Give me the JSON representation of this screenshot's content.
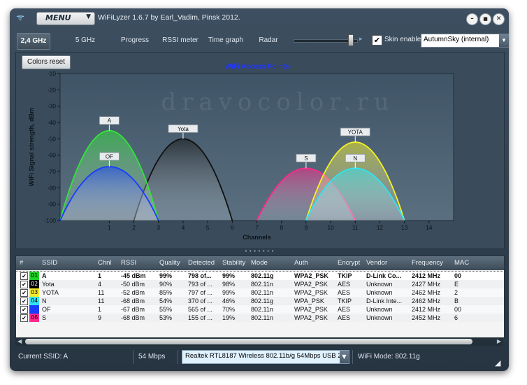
{
  "window": {
    "title": "WiFiLyzer 1.6.7 by Earl_Vadim,  Pinsk 2012.",
    "menu_label": "MENU",
    "controls": {
      "minimize": "–",
      "maximize": "■",
      "close": "✕"
    }
  },
  "toolbar": {
    "tabs": [
      "2,4 GHz",
      "5 GHz",
      "Progress",
      "RSSI meter",
      "Time graph",
      "Radar"
    ],
    "active_tab": "2,4 GHz",
    "slider_level": 0.88,
    "skin_enable_label": "Skin enable",
    "skin_enable_checked": true,
    "skin_value": "AutumnSky (internal)"
  },
  "graph": {
    "colors_reset_label": "Colors reset",
    "watermark": "dravocolor.ru"
  },
  "chart_data": {
    "type": "area",
    "title": "WiFi Access Points",
    "xlabel": "Channels",
    "ylabel": "WiFi Signal strength, dBm",
    "xlim": [
      -1,
      15
    ],
    "ylim": [
      -100,
      -10
    ],
    "x_ticks": [
      1,
      2,
      3,
      4,
      5,
      6,
      7,
      8,
      9,
      10,
      11,
      12,
      13,
      14
    ],
    "y_ticks": [
      -10,
      -20,
      -30,
      -40,
      -50,
      -60,
      -70,
      -80,
      -90,
      -100
    ],
    "grid": false,
    "series": [
      {
        "name": "A",
        "channel": 1,
        "rssi": -45,
        "color": "#33e33a"
      },
      {
        "name": "OF",
        "channel": 1,
        "rssi": -67,
        "color": "#1a3cff"
      },
      {
        "name": "Yota",
        "channel": 4,
        "rssi": -50,
        "color": "#111111"
      },
      {
        "name": "S",
        "channel": 9,
        "rssi": -68,
        "color": "#ff2a8c"
      },
      {
        "name": "YOTA",
        "channel": 11,
        "rssi": -52,
        "color": "#f5f02a"
      },
      {
        "name": "N",
        "channel": 11,
        "rssi": -68,
        "color": "#2fe4f2"
      }
    ]
  },
  "table": {
    "headers": [
      "#",
      "SSID",
      "Chnl",
      "RSSI",
      "Quality",
      "Detected",
      "Stability",
      "Mode",
      "Auth",
      "Encrypt",
      "Vendor",
      "Frequency",
      "MAC"
    ],
    "rows": [
      {
        "num": "01",
        "num_color": "#1dcf24",
        "num_text": "#000000",
        "ssid": "A",
        "chnl": "1",
        "rssi": "-45 dBm",
        "quality": "99%",
        "detected": "798 of...",
        "stability": "99%",
        "mode": "802.11g",
        "auth": "WPA2_PSK",
        "encrypt": "TKIP",
        "vendor": "D-Link Co...",
        "frequency": "2412 MHz",
        "mac": "00",
        "bold": true,
        "selected": true
      },
      {
        "num": "02",
        "num_color": "#000000",
        "num_text": "#ffffff",
        "ssid": "Yota",
        "chnl": "4",
        "rssi": "-50 dBm",
        "quality": "90%",
        "detected": "793 of ...",
        "stability": "98%",
        "mode": "802.11n",
        "auth": "WPA2_PSK",
        "encrypt": "AES",
        "vendor": "Unknown",
        "frequency": "2427 MHz",
        "mac": "E",
        "bold": false,
        "selected": false
      },
      {
        "num": "03",
        "num_color": "#f2e92c",
        "num_text": "#000000",
        "ssid": "YOTA",
        "chnl": "11",
        "rssi": "-52 dBm",
        "quality": "85%",
        "detected": "797 of ...",
        "stability": "99%",
        "mode": "802.11n",
        "auth": "WPA2_PSK",
        "encrypt": "AES",
        "vendor": "Unknown",
        "frequency": "2462 MHz",
        "mac": "2",
        "bold": false,
        "selected": false
      },
      {
        "num": "04",
        "num_color": "#2fe4f2",
        "num_text": "#000000",
        "ssid": "N",
        "chnl": "11",
        "rssi": "-68 dBm",
        "quality": "54%",
        "detected": "370 of ...",
        "stability": "46%",
        "mode": "802.11g",
        "auth": "WPA_PSK",
        "encrypt": "TKIP",
        "vendor": "D-Link Inte...",
        "frequency": "2462 MHz",
        "mac": "B",
        "bold": false,
        "selected": false
      },
      {
        "num": "05",
        "num_color": "#1a3cff",
        "num_text": "#1a3cff",
        "ssid": "OF",
        "chnl": "1",
        "rssi": "-67 dBm",
        "quality": "55%",
        "detected": "565 of ...",
        "stability": "70%",
        "mode": "802.11n",
        "auth": "WPA2_PSK",
        "encrypt": "AES",
        "vendor": "Unknown",
        "frequency": "2412 MHz",
        "mac": "00",
        "bold": false,
        "selected": false
      },
      {
        "num": "06",
        "num_color": "#ff2a8c",
        "num_text": "#000000",
        "ssid": "S",
        "chnl": "9",
        "rssi": "-68 dBm",
        "quality": "53%",
        "detected": "155 of ...",
        "stability": "19%",
        "mode": "802.11n",
        "auth": "WPA2_PSK",
        "encrypt": "AES",
        "vendor": "Unknown",
        "frequency": "2452 MHz",
        "mac": "6",
        "bold": false,
        "selected": false
      }
    ]
  },
  "status": {
    "current_ssid": "Current SSID: A",
    "rate": "54 Mbps",
    "adapter": "Realtek RTL8187 Wireless 802.11b/g 54Mbps USB 2.0",
    "wifi_mode": "WiFi Mode: 802.11g"
  }
}
